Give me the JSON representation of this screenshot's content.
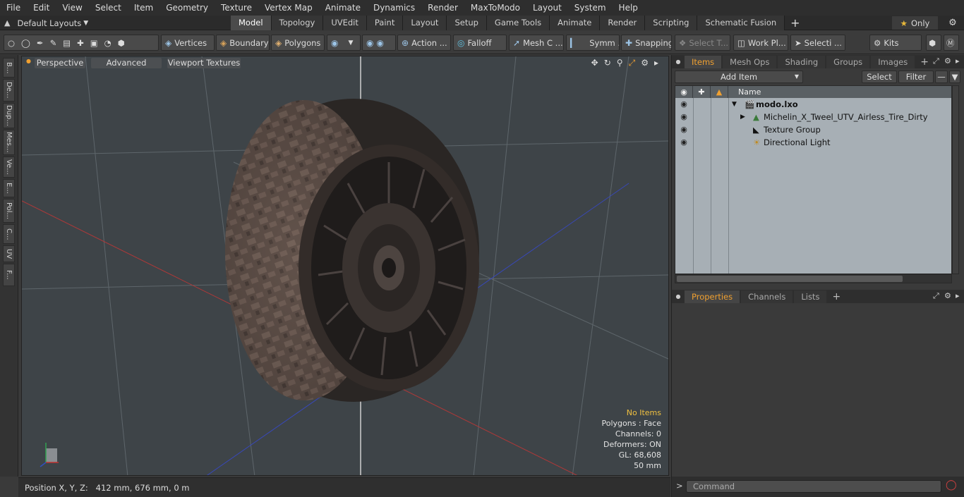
{
  "menu": [
    "File",
    "Edit",
    "View",
    "Select",
    "Item",
    "Geometry",
    "Texture",
    "Vertex Map",
    "Animate",
    "Dynamics",
    "Render",
    "MaxToModo",
    "Layout",
    "System",
    "Help"
  ],
  "layout_selector": "Default Layouts",
  "tabs": [
    "Model",
    "Topology",
    "UVEdit",
    "Paint",
    "Layout",
    "Setup",
    "Game Tools",
    "Animate",
    "Render",
    "Scripting",
    "Schematic Fusion"
  ],
  "active_tab": "Model",
  "only_label": "Only",
  "toolbar": {
    "vertices": "Vertices",
    "boundary": "Boundary",
    "polygons": "Polygons",
    "action": "Action ...",
    "falloff": "Falloff",
    "mesh_c": "Mesh C ...",
    "symm": "Symm ...",
    "snapping": "Snapping",
    "select_t": "Select T...",
    "work_pl": "Work Pl...",
    "selecti": "Selecti ...",
    "kits": "Kits"
  },
  "left_tabs": [
    "B...",
    "De...",
    "Dup...",
    "Mes...",
    "Ve...",
    "E...",
    "Pol...",
    "C...",
    "UV",
    "F..."
  ],
  "viewport": {
    "perspective": "Perspective",
    "advanced": "Advanced",
    "viewport_textures": "Viewport Textures",
    "stats": {
      "no_items": "No Items",
      "polygons": "Polygons : Face",
      "channels": "Channels: 0",
      "deformers": "Deformers: ON",
      "gl": "GL: 68,608",
      "size": "50 mm"
    }
  },
  "status": "Position X, Y, Z:   412 mm, 676 mm, 0 m",
  "items_panel": {
    "tabs": [
      "Items",
      "Mesh Ops",
      "Shading",
      "Groups",
      "Images"
    ],
    "add_item": "Add Item",
    "select": "Select",
    "filter": "Filter",
    "column_name": "Name",
    "rows": [
      {
        "label": "modo.lxo",
        "kind": "scene"
      },
      {
        "label": "Michelin_X_Tweel_UTV_Airless_Tire_Dirty",
        "kind": "mesh"
      },
      {
        "label": "Texture Group",
        "kind": "texture"
      },
      {
        "label": "Directional Light",
        "kind": "light"
      }
    ]
  },
  "props_panel": {
    "tabs": [
      "Properties",
      "Channels",
      "Lists"
    ]
  },
  "command_placeholder": "Command",
  "colors": {
    "accent": "#f0a030",
    "axis_x": "#c03030",
    "axis_y": "#30a050",
    "axis_z": "#3050c0"
  }
}
